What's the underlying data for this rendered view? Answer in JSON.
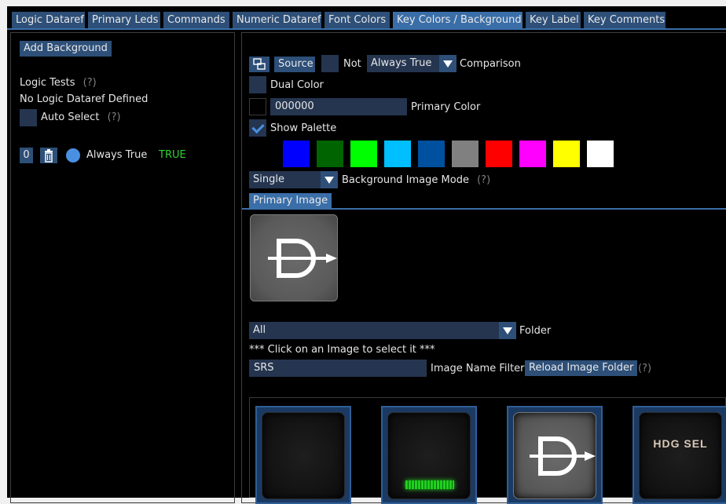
{
  "tabs": [
    {
      "label": "Logic Dataref"
    },
    {
      "label": "Primary Leds"
    },
    {
      "label": "Commands"
    },
    {
      "label": "Numeric Dataref"
    },
    {
      "label": "Font Colors"
    },
    {
      "label": "Key Colors / Background"
    },
    {
      "label": "Key Label"
    },
    {
      "label": "Key Comments"
    }
  ],
  "left": {
    "add_background_label": "Add Background",
    "logic_tests_label": "Logic Tests",
    "help_mark": "(?)",
    "no_logic_text": "No Logic Dataref Defined",
    "auto_select_label": "Auto Select",
    "entry": {
      "index": "0",
      "condition": "Always True",
      "result": "TRUE",
      "result_color": "#2ed12e"
    }
  },
  "right": {
    "source_label": "Source",
    "not_label": "Not",
    "comparison_value": "Always True",
    "comparison_label": "Comparison",
    "dual_color_label": "Dual Color",
    "primary_color_value": "000000",
    "primary_color_label": "Primary Color",
    "show_palette_label": "Show Palette",
    "palette": [
      "#000000",
      "#0000ff",
      "#006400",
      "#00ff00",
      "#00bfff",
      "#0050a0",
      "#808080",
      "#ff0000",
      "#ff00ff",
      "#ffff00",
      "#ffffff"
    ],
    "image_mode_value": "Single",
    "image_mode_label": "Background Image Mode",
    "help_mark": "(?)",
    "primary_image_tab": "Primary Image",
    "folder_value": "All",
    "folder_label": "Folder",
    "click_hint": "*** Click on an Image to select it ***",
    "name_filter_value": "SRS",
    "name_filter_label": "Image Name Filter",
    "reload_label": "Reload Image Folder",
    "thumb_text_hdg": "HDG SEL"
  },
  "colors": {
    "accent": "#3a6ea8",
    "button": "#2d4f78",
    "field": "#253550",
    "background": "#000000"
  }
}
